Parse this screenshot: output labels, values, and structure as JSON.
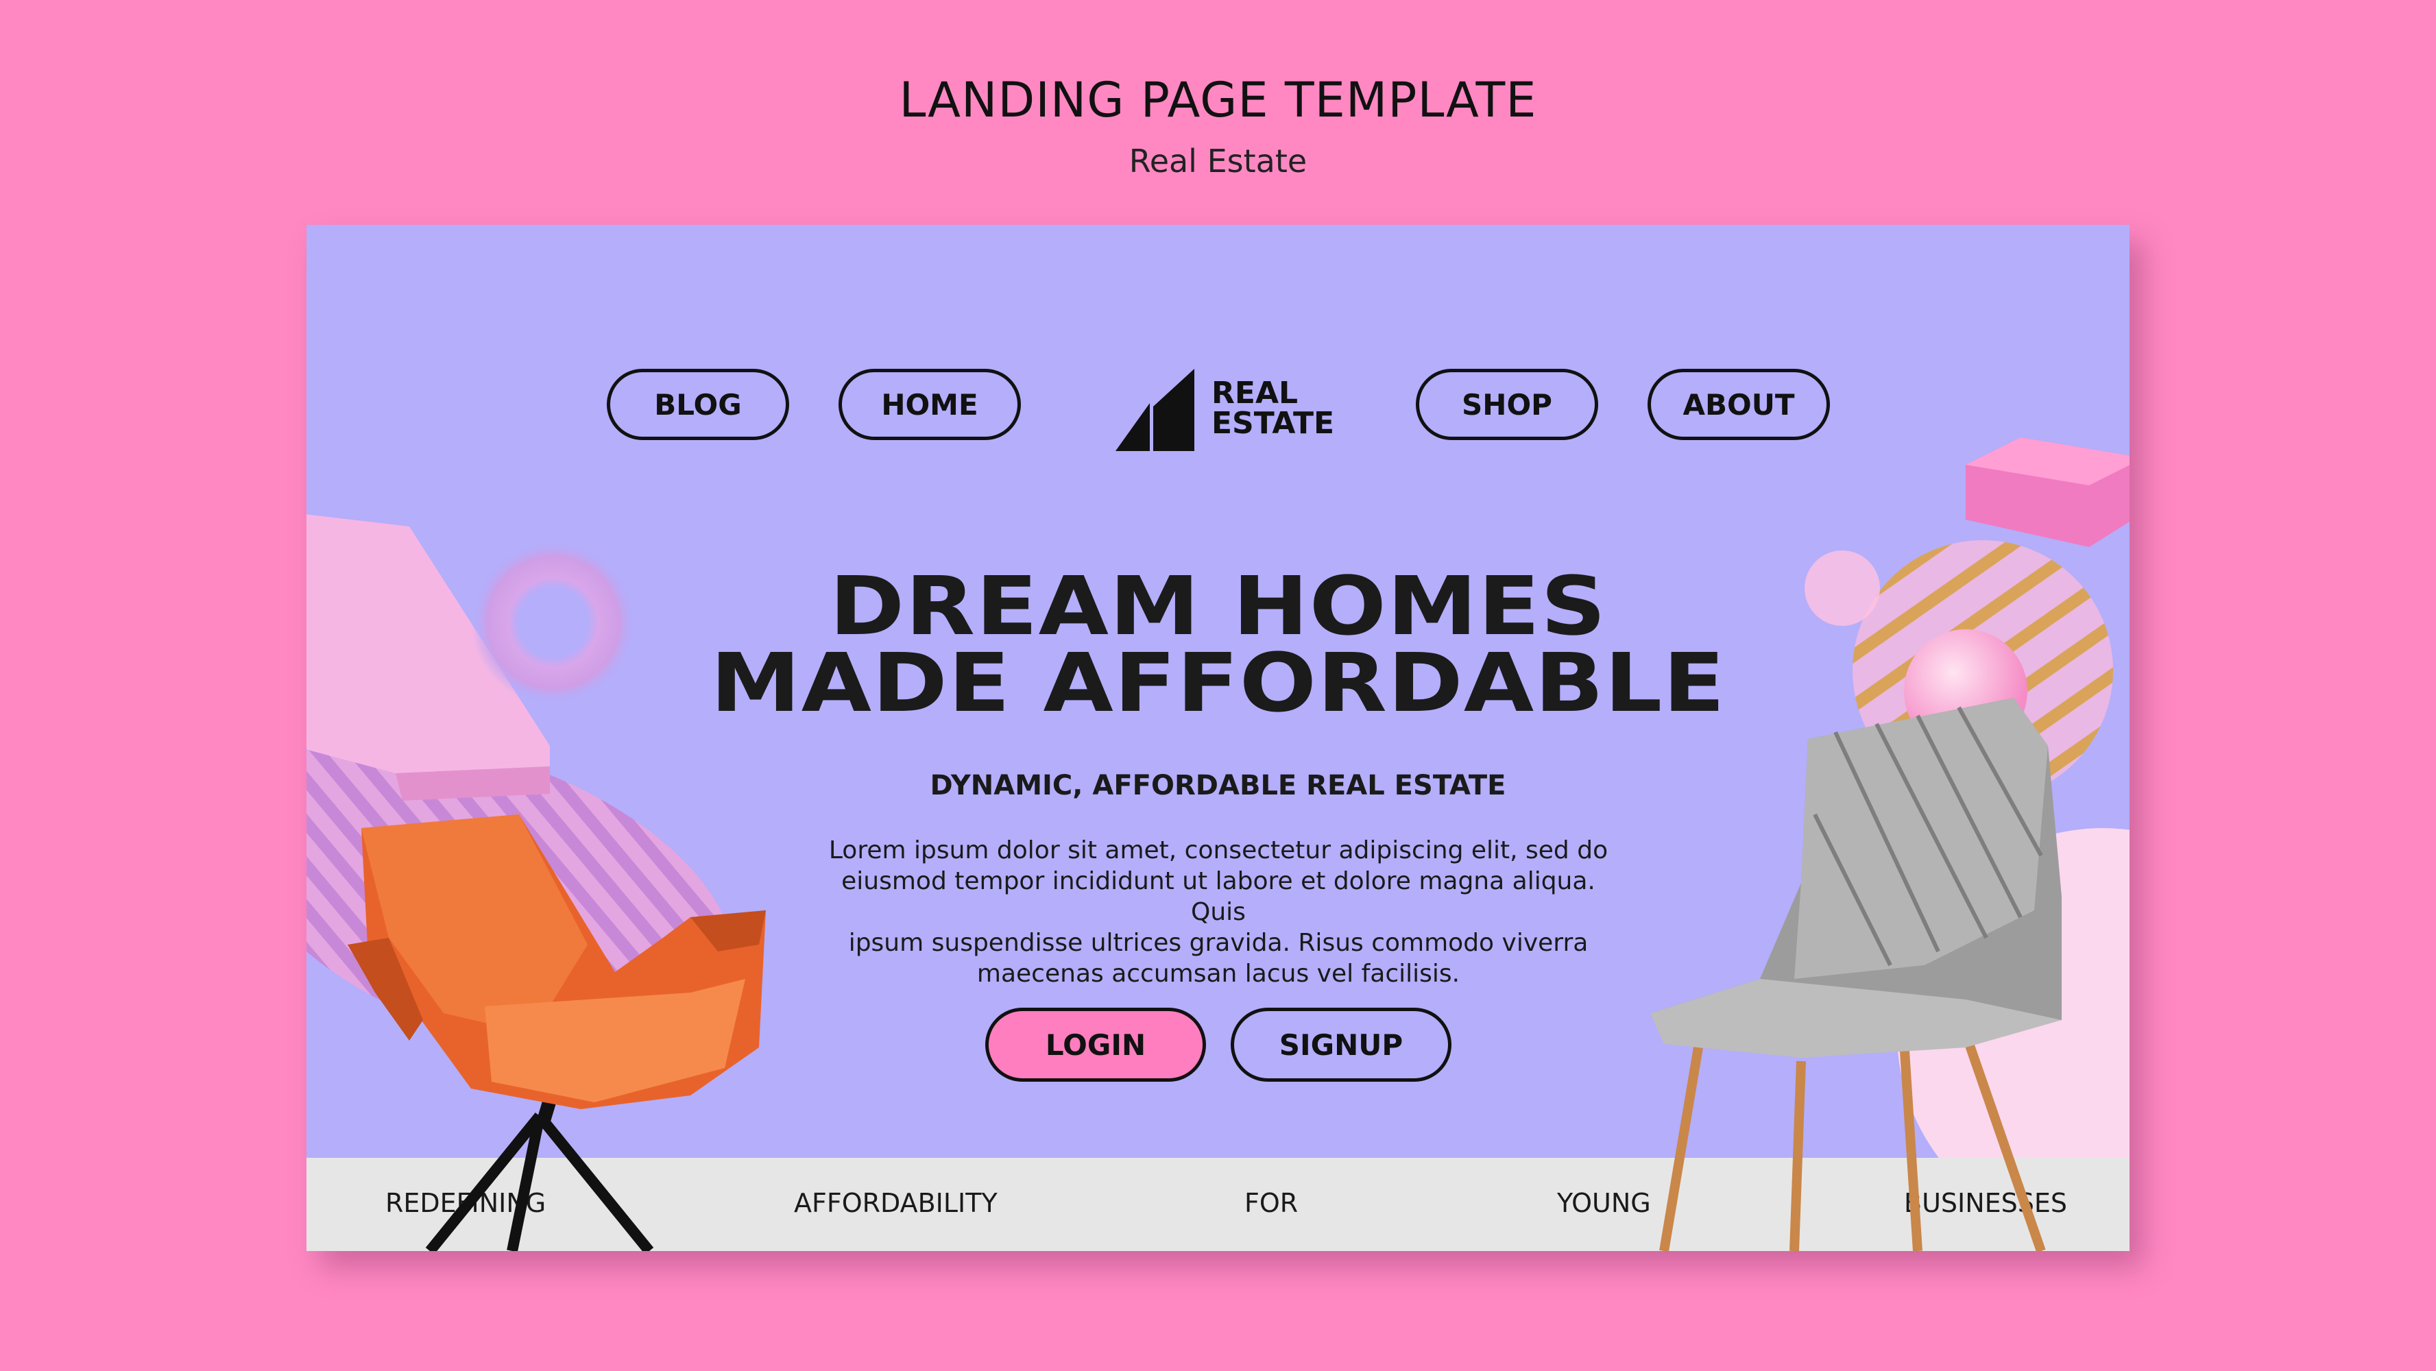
{
  "header": {
    "title": "LANDING PAGE TEMPLATE",
    "subtitle": "Real Estate"
  },
  "nav": {
    "items": [
      "BLOG",
      "HOME",
      "SHOP",
      "ABOUT"
    ],
    "logo_line1": "REAL",
    "logo_line2": "ESTATE"
  },
  "hero": {
    "headline_line1": "DREAM HOMES",
    "headline_line2": "MADE AFFORDABLE",
    "subheading": "DYNAMIC, AFFORDABLE REAL ESTATE",
    "body_lines": [
      "Lorem ipsum dolor sit amet, consectetur adipiscing elit, sed do",
      "eiusmod tempor incididunt ut labore et dolore magna aliqua. Quis",
      "ipsum suspendisse ultrices gravida. Risus commodo viverra",
      "maecenas accumsan lacus vel facilisis."
    ],
    "login_label": "LOGIN",
    "signup_label": "SIGNUP"
  },
  "ticker": {
    "words": [
      "REDEFINING",
      "AFFORDABILITY",
      "FOR",
      "YOUNG",
      "BUSINESSES"
    ]
  },
  "colors": {
    "page_background": "#ff88c3",
    "card_background": "#b4aefb",
    "login_button": "#ff7ebf",
    "ticker_background": "#e6e6e6",
    "chair_orange": "#e8632b",
    "chair_gray": "#9c9c9c"
  }
}
